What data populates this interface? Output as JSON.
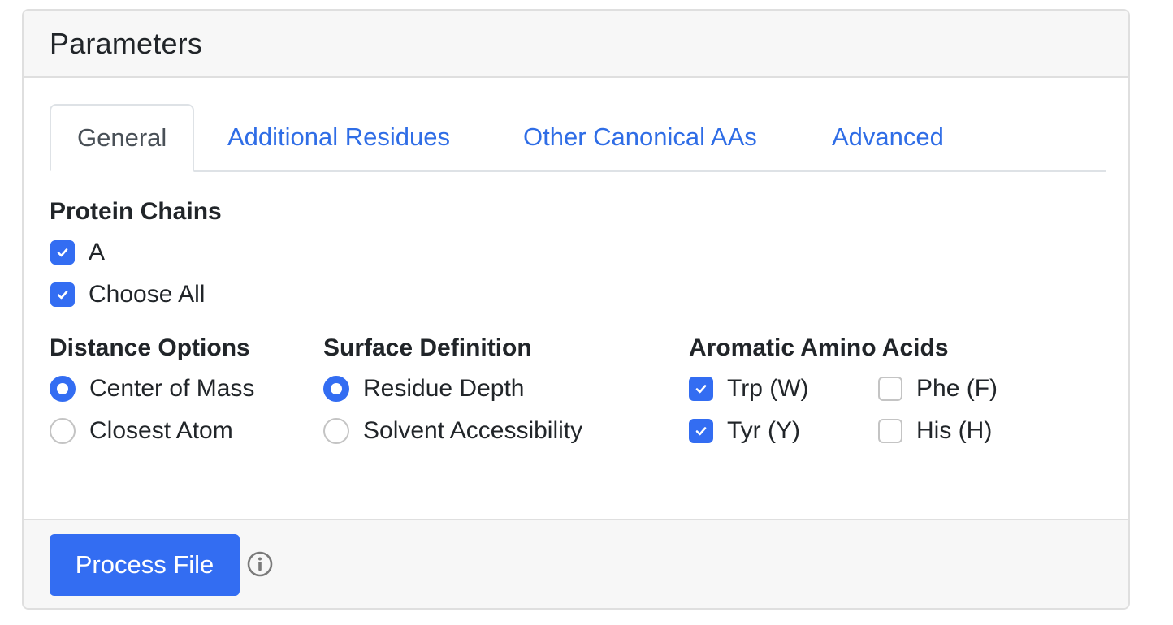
{
  "card": {
    "title": "Parameters"
  },
  "tabs": [
    {
      "label": "General",
      "active": true
    },
    {
      "label": "Additional Residues",
      "active": false
    },
    {
      "label": "Other Canonical AAs",
      "active": false
    },
    {
      "label": "Advanced",
      "active": false
    }
  ],
  "protein_chains": {
    "title": "Protein Chains",
    "options": [
      {
        "label": "A",
        "checked": true
      },
      {
        "label": "Choose All",
        "checked": true
      }
    ]
  },
  "distance_options": {
    "title": "Distance Options",
    "options": [
      {
        "label": "Center of Mass",
        "selected": true
      },
      {
        "label": "Closest Atom",
        "selected": false
      }
    ]
  },
  "surface_definition": {
    "title": "Surface Definition",
    "options": [
      {
        "label": "Residue Depth",
        "selected": true
      },
      {
        "label": "Solvent Accessibility",
        "selected": false
      }
    ]
  },
  "aromatic_amino_acids": {
    "title": "Aromatic Amino Acids",
    "options": [
      {
        "label": "Trp (W)",
        "checked": true
      },
      {
        "label": "Phe (F)",
        "checked": false
      },
      {
        "label": "Tyr (Y)",
        "checked": true
      },
      {
        "label": "His (H)",
        "checked": false
      }
    ]
  },
  "footer": {
    "process_button": "Process File",
    "info_icon": "info-circle-icon"
  },
  "colors": {
    "accent": "#336df2",
    "link": "#2f6de6",
    "header_bg": "#f7f7f7"
  }
}
